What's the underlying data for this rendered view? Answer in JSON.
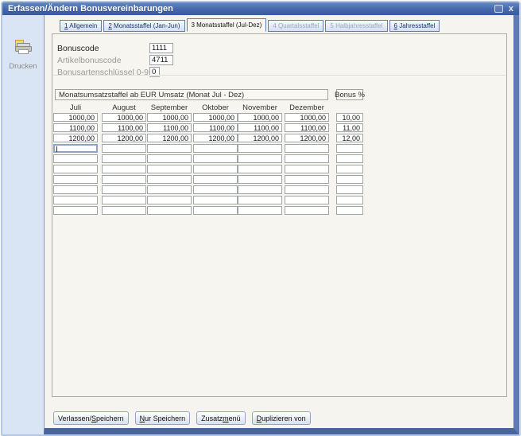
{
  "window": {
    "title": "Erfassen/Ändern Bonusvereinbarungen"
  },
  "sidebar": {
    "print_label": "Drucken"
  },
  "tabs": [
    {
      "key": "1",
      "post": " Allgemein",
      "underline": true,
      "active": false,
      "disabled": false
    },
    {
      "key": "2",
      "post": " Monatsstaffel (Jan-Jun)",
      "underline": true,
      "active": false,
      "disabled": false
    },
    {
      "key": "3",
      "post": " Monatsstaffel (Jul-Dez)",
      "underline": false,
      "active": true,
      "disabled": false
    },
    {
      "key": "4",
      "post": " Quartalsstaffel",
      "underline": false,
      "active": false,
      "disabled": true
    },
    {
      "key": "5",
      "post": " Halbjahresstaffel",
      "underline": false,
      "active": false,
      "disabled": true
    },
    {
      "key": "6",
      "post": " Jahresstaffel",
      "underline": true,
      "active": false,
      "disabled": false
    }
  ],
  "form": {
    "fields": [
      {
        "label": "Bonuscode",
        "value": "1111",
        "disabled": false,
        "size": "wide"
      },
      {
        "label": "Artikelbonuscode",
        "value": "4711",
        "disabled": true,
        "size": "wide"
      },
      {
        "label": "Bonusartenschlüssel 0-9",
        "value": "0",
        "disabled": true,
        "size": "small"
      }
    ]
  },
  "table": {
    "caption": "Monatsumsatzstaffel ab EUR Umsatz (Monat Jul - Dez)",
    "bonus_header": "Bonus %",
    "columns": [
      "Juli",
      "August",
      "September",
      "Oktober",
      "November",
      "Dezember"
    ],
    "rows": [
      {
        "months": [
          "1000,00",
          "1000,00",
          "1000,00",
          "1000,00",
          "1000,00",
          "1000,00"
        ],
        "bonus": "10,00"
      },
      {
        "months": [
          "1100,00",
          "1100,00",
          "1100,00",
          "1100,00",
          "1100,00",
          "1100,00"
        ],
        "bonus": "11,00"
      },
      {
        "months": [
          "1200,00",
          "1200,00",
          "1200,00",
          "1200,00",
          "1200,00",
          "1200,00"
        ],
        "bonus": "12,00"
      },
      {
        "months": [
          "",
          "",
          "",
          "",
          "",
          ""
        ],
        "bonus": ""
      },
      {
        "months": [
          "",
          "",
          "",
          "",
          "",
          ""
        ],
        "bonus": ""
      },
      {
        "months": [
          "",
          "",
          "",
          "",
          "",
          ""
        ],
        "bonus": ""
      },
      {
        "months": [
          "",
          "",
          "",
          "",
          "",
          ""
        ],
        "bonus": ""
      },
      {
        "months": [
          "",
          "",
          "",
          "",
          "",
          ""
        ],
        "bonus": ""
      },
      {
        "months": [
          "",
          "",
          "",
          "",
          "",
          ""
        ],
        "bonus": ""
      },
      {
        "months": [
          "",
          "",
          "",
          "",
          "",
          ""
        ],
        "bonus": ""
      }
    ],
    "focus": {
      "row": 3,
      "col": 0
    }
  },
  "buttons": [
    {
      "pre": "Verlassen/",
      "key": "S",
      "post": "peichern"
    },
    {
      "pre": "",
      "key": "N",
      "post": "ur Speichern"
    },
    {
      "pre": "Zusatz",
      "key": "m",
      "post": "enü"
    },
    {
      "pre": "",
      "key": "D",
      "post": "uplizieren von"
    }
  ],
  "colors": {
    "titlebar_top": "#6487c6",
    "titlebar_bottom": "#3a5a9e",
    "frame_blue": "#49659d",
    "client_bg": "#d9e4f5",
    "panel_bg": "#f5f4ee",
    "focus_border": "#8da4c7"
  }
}
